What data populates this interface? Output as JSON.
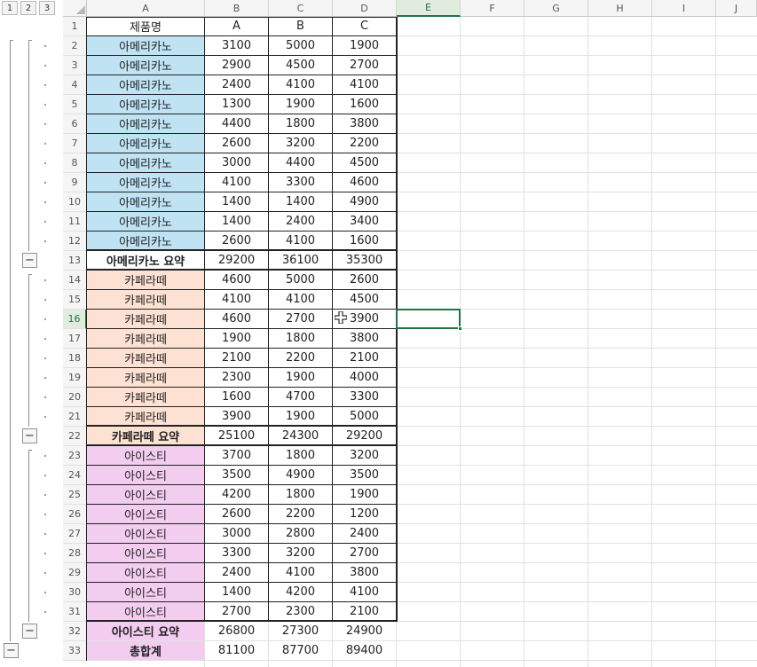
{
  "outline_levels": [
    "1",
    "2",
    "3"
  ],
  "columns": [
    "A",
    "B",
    "C",
    "D",
    "E",
    "F",
    "G",
    "H",
    "I",
    "J"
  ],
  "active_column": "E",
  "active_row": "16",
  "header_row": {
    "row": "1",
    "product": "제품명",
    "a": "A",
    "b": "B",
    "c": "C"
  },
  "groups": [
    {
      "name": "americano",
      "fill": "#bfe3f3",
      "rows": [
        {
          "row": "2",
          "product": "아메리카노",
          "a": "3100",
          "b": "5000",
          "c": "1900"
        },
        {
          "row": "3",
          "product": "아메리카노",
          "a": "2900",
          "b": "4500",
          "c": "2700"
        },
        {
          "row": "4",
          "product": "아메리카노",
          "a": "2400",
          "b": "4100",
          "c": "4100"
        },
        {
          "row": "5",
          "product": "아메리카노",
          "a": "1300",
          "b": "1900",
          "c": "1600"
        },
        {
          "row": "6",
          "product": "아메리카노",
          "a": "4400",
          "b": "1800",
          "c": "3800"
        },
        {
          "row": "7",
          "product": "아메리카노",
          "a": "2600",
          "b": "3200",
          "c": "2200"
        },
        {
          "row": "8",
          "product": "아메리카노",
          "a": "3000",
          "b": "4400",
          "c": "4500"
        },
        {
          "row": "9",
          "product": "아메리카노",
          "a": "4100",
          "b": "3300",
          "c": "4600"
        },
        {
          "row": "10",
          "product": "아메리카노",
          "a": "1400",
          "b": "1400",
          "c": "4900"
        },
        {
          "row": "11",
          "product": "아메리카노",
          "a": "1400",
          "b": "2400",
          "c": "3400"
        },
        {
          "row": "12",
          "product": "아메리카노",
          "a": "2600",
          "b": "4100",
          "c": "1600"
        }
      ],
      "summary": {
        "row": "13",
        "product": "아메리카노 요약",
        "a": "29200",
        "b": "36100",
        "c": "35300"
      }
    },
    {
      "name": "cafelatte",
      "fill": "#fde1d3",
      "rows": [
        {
          "row": "14",
          "product": "카페라떼",
          "a": "4600",
          "b": "5000",
          "c": "2600"
        },
        {
          "row": "15",
          "product": "카페라떼",
          "a": "4100",
          "b": "4100",
          "c": "4500"
        },
        {
          "row": "16",
          "product": "카페라떼",
          "a": "4600",
          "b": "2700",
          "c": "3900"
        },
        {
          "row": "17",
          "product": "카페라떼",
          "a": "1900",
          "b": "1800",
          "c": "3800"
        },
        {
          "row": "18",
          "product": "카페라떼",
          "a": "2100",
          "b": "2200",
          "c": "2100"
        },
        {
          "row": "19",
          "product": "카페라떼",
          "a": "2300",
          "b": "1900",
          "c": "4000"
        },
        {
          "row": "20",
          "product": "카페라떼",
          "a": "1600",
          "b": "4700",
          "c": "3300"
        },
        {
          "row": "21",
          "product": "카페라떼",
          "a": "3900",
          "b": "1900",
          "c": "5000"
        }
      ],
      "summary": {
        "row": "22",
        "product": "카페라떼 요약",
        "a": "25100",
        "b": "24300",
        "c": "29200"
      }
    },
    {
      "name": "icedtea",
      "fill": "#f2cdef",
      "rows": [
        {
          "row": "23",
          "product": "아이스티",
          "a": "3700",
          "b": "1800",
          "c": "3200"
        },
        {
          "row": "24",
          "product": "아이스티",
          "a": "3500",
          "b": "4900",
          "c": "3500"
        },
        {
          "row": "25",
          "product": "아이스티",
          "a": "4200",
          "b": "1800",
          "c": "1900"
        },
        {
          "row": "26",
          "product": "아이스티",
          "a": "2600",
          "b": "2200",
          "c": "1200"
        },
        {
          "row": "27",
          "product": "아이스티",
          "a": "3000",
          "b": "2800",
          "c": "2400"
        },
        {
          "row": "28",
          "product": "아이스티",
          "a": "3300",
          "b": "3200",
          "c": "2700"
        },
        {
          "row": "29",
          "product": "아이스티",
          "a": "2400",
          "b": "4100",
          "c": "3800"
        },
        {
          "row": "30",
          "product": "아이스티",
          "a": "1400",
          "b": "4200",
          "c": "4100"
        },
        {
          "row": "31",
          "product": "아이스티",
          "a": "2700",
          "b": "2300",
          "c": "2100"
        }
      ],
      "summary": {
        "row": "32",
        "product": "아이스티 요약",
        "a": "26800",
        "b": "27300",
        "c": "24900"
      }
    }
  ],
  "grand_total": {
    "row": "33",
    "product": "총합계",
    "a": "81100",
    "b": "87700",
    "c": "89400",
    "fill": "#f2cdef"
  },
  "collapse_symbol": "−",
  "colors": {
    "selection": "#217346",
    "header_bg": "#f5f5f5",
    "gridline": "#e1e1e1"
  },
  "icons": {
    "cursor": "cell-select-cross-cursor"
  }
}
